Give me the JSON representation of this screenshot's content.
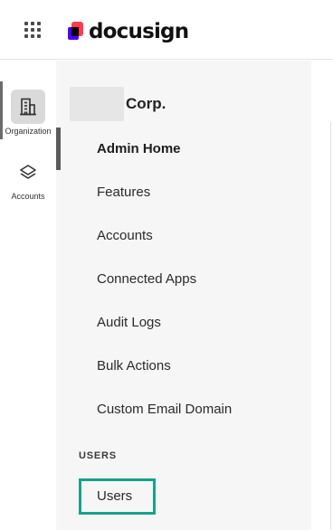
{
  "header": {
    "app_switcher_icon": "grid-icon",
    "logo_text": "docusign"
  },
  "rail": {
    "items": [
      {
        "label": "Organization",
        "icon": "building-icon",
        "active": true
      },
      {
        "label": "Accounts",
        "icon": "layers-icon",
        "active": false
      }
    ]
  },
  "panel": {
    "org_name_suffix": "Corp.",
    "nav": [
      {
        "label": "Admin Home",
        "active": true
      },
      {
        "label": "Features",
        "active": false
      },
      {
        "label": "Accounts",
        "active": false
      },
      {
        "label": "Connected Apps",
        "active": false
      },
      {
        "label": "Audit Logs",
        "active": false
      },
      {
        "label": "Bulk Actions",
        "active": false
      },
      {
        "label": "Custom Email Domain",
        "active": false
      }
    ],
    "users_section": {
      "title": "USERS",
      "items": [
        {
          "label": "Users",
          "highlighted": true
        }
      ]
    }
  },
  "colors": {
    "highlight": "#17a38b",
    "active_indicator": "#5b5b5b",
    "panel_bg": "#f6f6f6"
  }
}
